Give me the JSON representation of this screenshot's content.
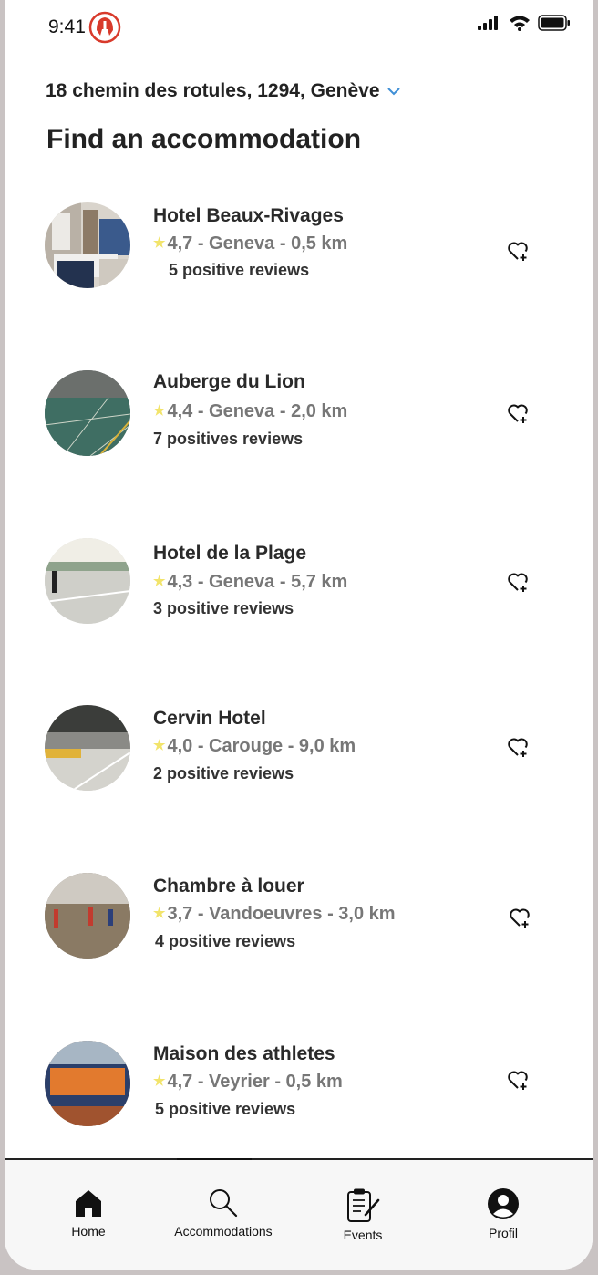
{
  "status_bar": {
    "time": "9:41"
  },
  "header": {
    "address": "18 chemin des rotules, 1294, Genève",
    "title": "Find an accommodation"
  },
  "accommodations": [
    {
      "name": "Hotel Beaux-Rivages",
      "rating_line": "4,7 - Geneva - 0,5 km",
      "reviews": "5 positive reviews"
    },
    {
      "name": "Auberge du Lion",
      "rating_line": "4,4 - Geneva - 2,0 km",
      "reviews": "7 positives reviews"
    },
    {
      "name": "Hotel de la Plage",
      "rating_line": "4,3 - Geneva - 5,7 km",
      "reviews": "3 positive reviews"
    },
    {
      "name": "Cervin Hotel",
      "rating_line": "4,0 - Carouge - 9,0 km",
      "reviews": "2 positive reviews"
    },
    {
      "name": "Chambre à louer",
      "rating_line": "3,7 - Vandoeuvres - 3,0 km",
      "reviews": "4 positive reviews"
    },
    {
      "name": "Maison des athletes",
      "rating_line": "4,7 - Veyrier - 0,5 km",
      "reviews": "5 positive reviews"
    }
  ],
  "tabbar": {
    "home": "Home",
    "accommodations": "Accommodations",
    "events": "Events",
    "profil": "Profil"
  },
  "icons": {
    "star": "star-icon",
    "favorite": "heart-plus-icon",
    "dropdown": "chevron-down-icon"
  },
  "colors": {
    "star": "#f2e46b",
    "chevron": "#3f8fd6",
    "brand_logo": "#d83a2b"
  }
}
